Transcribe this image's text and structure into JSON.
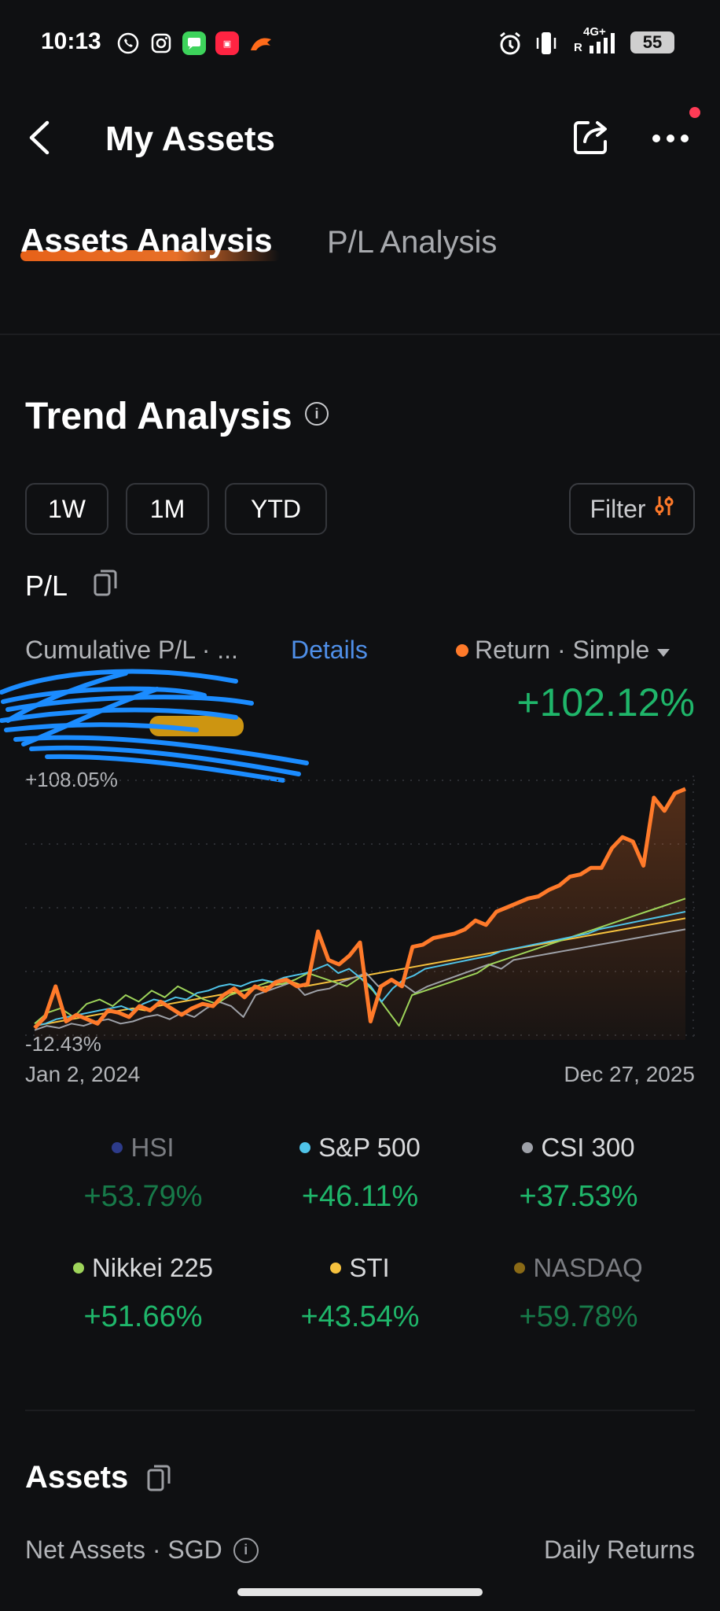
{
  "status_bar": {
    "time": "10:13",
    "network": "4G+",
    "roaming": "R",
    "battery": "55"
  },
  "header": {
    "title": "My Assets"
  },
  "tabs": [
    {
      "label": "Assets Analysis",
      "active": true
    },
    {
      "label": "P/L Analysis",
      "active": false
    }
  ],
  "trend": {
    "title": "Trend Analysis",
    "ranges": [
      "1W",
      "1M",
      "YTD"
    ],
    "filter_label": "Filter"
  },
  "pl": {
    "label": "P/L",
    "cumulative_label": "Cumulative P/L · ...",
    "details_label": "Details",
    "return_label": "Return · Simple",
    "return_value": "+102.12%"
  },
  "chart_data": {
    "type": "line",
    "y_max_label": "+108.05%",
    "y_min_label": "-12.43%",
    "x_start_label": "Jan 2, 2024",
    "x_end_label": "Dec 27, 2025",
    "ylim": [
      -12.43,
      108.05
    ],
    "grid": "horizontal dotted",
    "series": [
      {
        "name": "",
        "color": "#ff7a2a",
        "values": [
          -7,
          -2,
          12,
          -4,
          -1,
          -3,
          -5,
          1,
          0,
          -2,
          3,
          1,
          5,
          2,
          -1,
          2,
          4,
          3,
          8,
          11,
          7,
          12,
          10,
          14,
          15,
          12,
          13,
          37,
          24,
          22,
          26,
          32,
          -4,
          12,
          15,
          12,
          30,
          31,
          34,
          35,
          36,
          38,
          42,
          40,
          46,
          48,
          50,
          52,
          53,
          56,
          58,
          62,
          63,
          66,
          66,
          75,
          80,
          78,
          67,
          98,
          92,
          100,
          102
        ]
      },
      {
        "name": "S&P 500",
        "color": "#4fc3e8",
        "values": [
          -6,
          -5,
          -3,
          -2,
          -1,
          0,
          1,
          2,
          3,
          1,
          4,
          6,
          5,
          7,
          6,
          9,
          10,
          12,
          13,
          12,
          14,
          15,
          14,
          16,
          17,
          18,
          20,
          22,
          18,
          20,
          16,
          12,
          5,
          11,
          15,
          17,
          20,
          21,
          22,
          23,
          24,
          25,
          26,
          28,
          29,
          30,
          31,
          32,
          33,
          34,
          35,
          36,
          38,
          39,
          40,
          41,
          42,
          43,
          44,
          45,
          46
        ]
      },
      {
        "name": "CSI 300",
        "color": "#9ea1a8",
        "values": [
          -8,
          -6,
          -7,
          -5,
          -6,
          -4,
          -3,
          -5,
          -4,
          -2,
          -1,
          -3,
          0,
          -2,
          2,
          5,
          3,
          -2,
          8,
          10,
          12,
          14,
          8,
          10,
          11,
          14,
          16,
          18,
          12,
          15,
          13,
          9,
          12,
          14,
          16,
          18,
          20,
          22,
          20,
          24,
          25,
          26,
          27,
          28,
          29,
          30,
          31,
          32,
          33,
          34,
          35,
          36,
          37,
          38
        ]
      },
      {
        "name": "Nikkei 225",
        "color": "#9ed45a",
        "values": [
          -5,
          0,
          2,
          -2,
          4,
          6,
          3,
          8,
          5,
          10,
          7,
          12,
          9,
          6,
          4,
          8,
          10,
          12,
          14,
          13,
          15,
          18,
          16,
          14,
          12,
          16,
          10,
          2,
          -6,
          8,
          10,
          12,
          14,
          16,
          18,
          22,
          24,
          26,
          28,
          30,
          32,
          34,
          36,
          38,
          40,
          42,
          44,
          46,
          48,
          50,
          52
        ]
      },
      {
        "name": "STI",
        "color": "#f6c23e",
        "values": [
          -6,
          -5,
          -4,
          -3,
          -2,
          -1,
          0,
          1,
          2,
          1,
          3,
          4,
          5,
          6,
          7,
          8,
          9,
          10,
          11,
          12,
          13,
          14,
          12,
          13,
          14,
          15,
          16,
          17,
          18,
          19,
          20,
          21,
          22,
          23,
          24,
          25,
          26,
          27,
          28,
          29,
          30,
          31,
          32,
          33,
          34,
          35,
          36,
          37,
          38,
          39,
          40,
          41,
          42,
          43
        ]
      }
    ]
  },
  "benchmarks": [
    {
      "name": "HSI",
      "value": "+53.79%",
      "color": "#2d3b8a",
      "dim": true
    },
    {
      "name": "S&P 500",
      "value": "+46.11%",
      "color": "#4fc3e8",
      "dim": false
    },
    {
      "name": "CSI 300",
      "value": "+37.53%",
      "color": "#9ea1a8",
      "dim": false
    },
    {
      "name": "Nikkei 225",
      "value": "+51.66%",
      "color": "#9ed45a",
      "dim": false
    },
    {
      "name": "STI",
      "value": "+43.54%",
      "color": "#f6c23e",
      "dim": false
    },
    {
      "name": "NASDAQ",
      "value": "+59.78%",
      "color": "#8a6a16",
      "dim": true
    }
  ],
  "assets": {
    "title": "Assets",
    "net_assets_label": "Net Assets · SGD",
    "daily_returns_label": "Daily Returns"
  }
}
